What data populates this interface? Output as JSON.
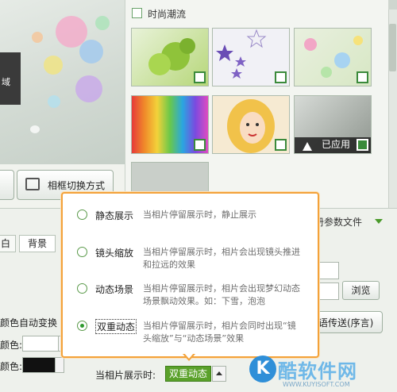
{
  "preview": {
    "text_fragment": "域"
  },
  "buttons": {
    "frame_switch_label": "相框切换方式"
  },
  "gallery": {
    "title": "时尚潮流",
    "applied_label": "已应用",
    "thumbs": [
      "leaves",
      "stars",
      "bubbles",
      "rainbow-stripes",
      "cartoon-girl",
      "swirl-applied"
    ]
  },
  "lower": {
    "tabs": [
      "白",
      "背景"
    ],
    "param_label": "册参数文件",
    "browse_label": "浏览",
    "send_label": "语传送(序言)",
    "color_auto_label": "颜色自动变换",
    "color_label_1": "颜色:",
    "color_label_2": "颜色:",
    "dwell_label": "当相片展示时:",
    "dwell_value": "双重动态"
  },
  "popup": {
    "options": [
      {
        "name": "静态展示",
        "desc": "当相片停留展示时，静止展示",
        "selected": false
      },
      {
        "name": "镜头缩放",
        "desc": "当相片停留展示时，相片会出现镜头推进和拉远的效果",
        "selected": false
      },
      {
        "name": "动态场景",
        "desc": "当相片停留展示时，相片会出现梦幻动态场景飘动效果。如：下雪，泡泡",
        "selected": false
      },
      {
        "name": "双重动态",
        "desc": "当相片停留展示时，相片会同时出现“镜头缩放”与“动态场景”效果",
        "selected": true
      }
    ]
  },
  "watermark": {
    "logo": "K",
    "text": "酷软件网",
    "sub": "WWW.KUYISOFT.COM"
  },
  "colors": {
    "accent_green": "#5aa12a",
    "popup_border": "#f3a23a"
  }
}
